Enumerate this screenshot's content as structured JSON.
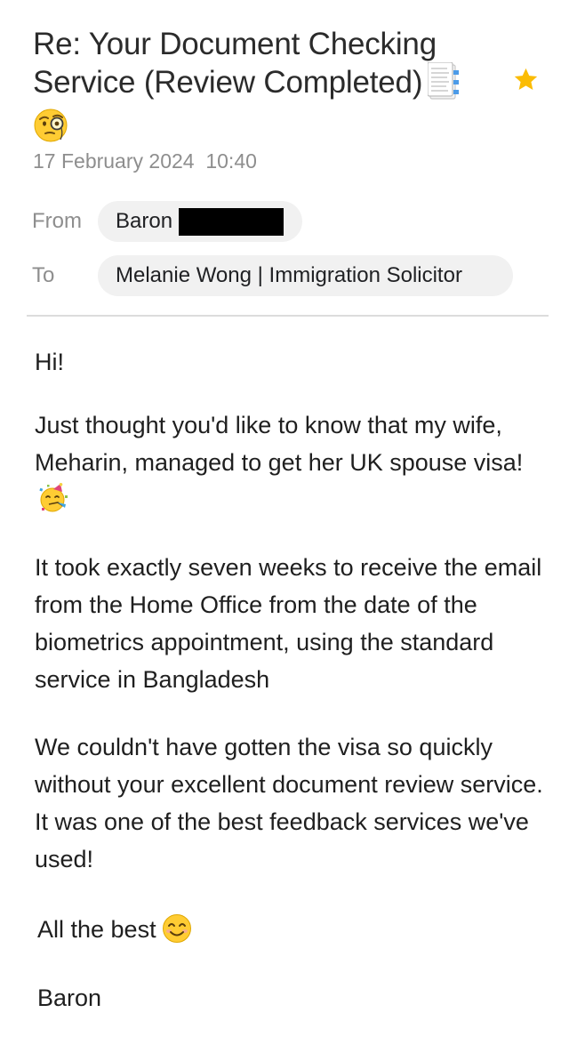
{
  "email": {
    "subject": "Re: Your Document Checking Service (Review Completed)",
    "subject_icons": [
      "bookmark-tabs-icon",
      "face-with-monocle-icon"
    ],
    "starred": true,
    "date": "17 February 2024  10:40",
    "from_label": "From",
    "from_name": "Baron",
    "to_label": "To",
    "to_name": "Melanie Wong | Immigration Solicitor",
    "body": {
      "greeting": "Hi!",
      "p1": "Just thought you'd like to know that my wife, Meharin, managed to get her UK spouse visa!",
      "p1_icon": "partying-face-icon",
      "p2": "It took exactly seven weeks to receive the email from the Home Office from the date of the biometrics appointment, using the standard service in Bangladesh",
      "p3": "We couldn't have gotten the visa so quickly without your excellent document review service. It was one of the best feedback services we've used!",
      "signoff": "All the best",
      "signoff_icon": "smiling-face-icon",
      "signature": "Baron"
    }
  },
  "colors": {
    "star": "#FBBC04",
    "chip_bg": "#f1f1f1",
    "muted_text": "#8e8e8e"
  }
}
